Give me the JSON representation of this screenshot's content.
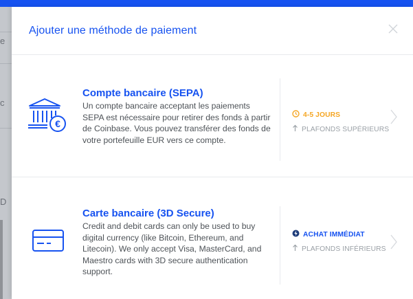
{
  "background": {
    "fragments": [
      "e",
      "c",
      "D"
    ]
  },
  "modal": {
    "title": "Ajouter une méthode de paiement",
    "close_icon": "close-icon"
  },
  "options": [
    {
      "icon": "bank-euro-icon",
      "title": "Compte bancaire (SEPA)",
      "description": "Un compte bancaire acceptant les paiements SEPA est nécessaire pour retirer des fonds à partir de Coinbase. Vous pouvez transférer des fonds de votre portefeuille EUR vers ce compte.",
      "timing_icon": "clock-icon",
      "timing": "4-5 JOURS",
      "timing_color": "#f5a623",
      "limit_icon": "arrow-up-icon",
      "limit": "PLAFONDS SUPÉRIEURS"
    },
    {
      "icon": "credit-card-icon",
      "title": "Carte bancaire (3D Secure)",
      "description": "Credit and debit cards can only be used to buy digital currency (like Bitcoin, Ethereum, and Litecoin). We only accept Visa, MasterCard, and Maestro cards with 3D secure authentication support.",
      "timing_icon": "lightning-icon",
      "timing": "ACHAT IMMÉDIAT",
      "timing_color": "#1652f0",
      "limit_icon": "arrow-up-icon",
      "limit": "PLAFONDS INFÉRIEURS"
    }
  ],
  "colors": {
    "accent": "#1652f0",
    "text": "#4d5257",
    "muted": "#9aa0a6",
    "divider": "#e8eaed"
  }
}
